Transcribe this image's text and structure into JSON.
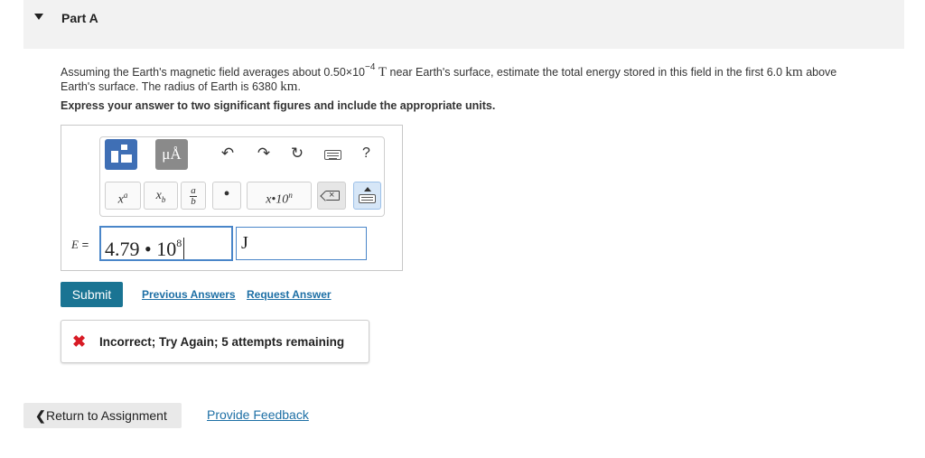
{
  "part": {
    "title": "Part A"
  },
  "question": {
    "text_1": "Assuming the Earth's magnetic field averages about 0.50",
    "times": "×",
    "base": "10",
    "exponent": "−4",
    "unit_T": "T",
    "text_2": " near Earth's surface, estimate the total energy stored in this field in the first 6.0 ",
    "unit_km": "km",
    "text_3": " above",
    "text_4": "Earth's surface. The radius of Earth is 6380 ",
    "unit_km_2": "km",
    "text_5": "."
  },
  "instruction": "Express your answer to two significant figures and include the appropriate units.",
  "toolbar": {
    "units_button": "μÅ",
    "undo_icon": "↶",
    "redo_icon": "↷",
    "reset_icon": "↻",
    "help_label": "?",
    "superscript_label": "x",
    "superscript_sup": "a",
    "subscript_label": "x",
    "subscript_sub": "b",
    "fraction_num": "a",
    "fraction_den": "b",
    "dot_label": "•",
    "sci_notation_label": "x•10",
    "sci_notation_sup": "n",
    "backspace_x": "×"
  },
  "answer": {
    "variable": "E",
    "equals": "=",
    "value_mantissa": "4.79 • 10",
    "value_exponent": "8",
    "unit": "J"
  },
  "actions": {
    "submit": "Submit",
    "previous_answers": "Previous Answers",
    "request_answer": "Request Answer"
  },
  "feedback": {
    "icon": "✖",
    "message": "Incorrect; Try Again; 5 attempts remaining"
  },
  "footer": {
    "return_chevron": "❮",
    "return_label": "Return to Assignment",
    "provide_feedback": "Provide Feedback"
  },
  "colors": {
    "submit_bg": "#1a7493",
    "link": "#1d6fa5",
    "error": "#d81b25",
    "input_border": "#4a86c9",
    "template_button": "#3f6fb5"
  }
}
